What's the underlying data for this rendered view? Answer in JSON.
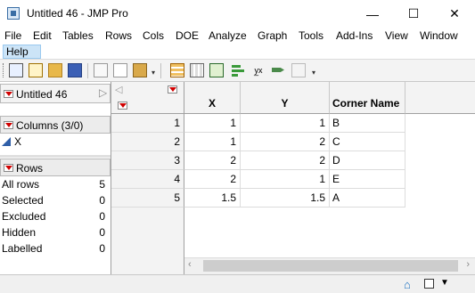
{
  "window": {
    "title": "Untitled 46 - JMP Pro",
    "minimize_glyph": "—",
    "maximize_glyph": "☐",
    "close_glyph": "✕"
  },
  "menu": {
    "items": [
      "File",
      "Edit",
      "Tables",
      "Rows",
      "Cols",
      "DOE",
      "Analyze",
      "Graph",
      "Tools",
      "Add-Ins",
      "View",
      "Window"
    ],
    "help": "Help"
  },
  "toolbar": {
    "icons": [
      "new-data-table-icon",
      "new-script-icon",
      "open-folder-icon",
      "save-icon",
      "cut-icon",
      "copy-icon",
      "paste-icon",
      "data-table-icon",
      "report-icon",
      "grid-layout-icon",
      "distribution-icon",
      "fit-y-by-x-icon",
      "fit-model-icon",
      "graph-builder-icon"
    ]
  },
  "left_panel": {
    "table_name": "Untitled 46",
    "columns_header": "Columns (3/0)",
    "columns": [
      "X"
    ],
    "rows_header": "Rows",
    "row_stats": [
      {
        "label": "All rows",
        "value": "5"
      },
      {
        "label": "Selected",
        "value": "0"
      },
      {
        "label": "Excluded",
        "value": "0"
      },
      {
        "label": "Hidden",
        "value": "0"
      },
      {
        "label": "Labelled",
        "value": "0"
      }
    ]
  },
  "table": {
    "columns": [
      "X",
      "Y",
      "Corner Name"
    ],
    "rows": [
      {
        "num": "1",
        "x": "1",
        "y": "1",
        "name": "B"
      },
      {
        "num": "2",
        "x": "1",
        "y": "2",
        "name": "C"
      },
      {
        "num": "3",
        "x": "2",
        "y": "2",
        "name": "D"
      },
      {
        "num": "4",
        "x": "2",
        "y": "1",
        "name": "E"
      },
      {
        "num": "5",
        "x": "1.5",
        "y": "1.5",
        "name": "A"
      }
    ]
  },
  "status": {
    "icons": [
      "home-icon",
      "window-icon",
      "dropdown-icon"
    ]
  }
}
